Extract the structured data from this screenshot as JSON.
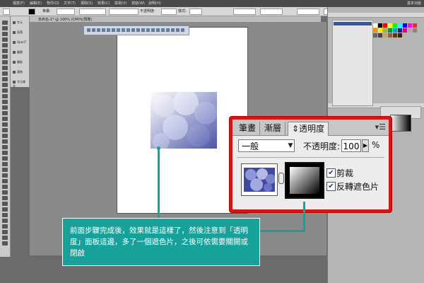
{
  "menubar": {
    "items": [
      "檔案(F)",
      "編輯(E)",
      "物件(O)",
      "文字(T)",
      "選取(S)",
      "效果(C)",
      "檢視(V)",
      "視窗(W)",
      "說明(H)"
    ],
    "workspace": "基本功能"
  },
  "control_bar": {
    "stroke_label": "筆畫:",
    "opacity_label": "不透明度:",
    "style_label": "樣式:"
  },
  "doc_tab": {
    "title": "未命名-1* @ 100% (CMYK/預覽)"
  },
  "left_panel": {
    "items": [
      "字元",
      "段落",
      "OpenT",
      "圖層",
      "畫板",
      "連結",
      "字元樣式"
    ]
  },
  "right_panel": {
    "swatch_colors": [
      "#ffffff",
      "#000000",
      "#ff0000",
      "#ffff00",
      "#00ff00",
      "#00ffff",
      "#0000ff",
      "#ff00ff",
      "#e6332a",
      "#f39800",
      "#fff100",
      "#8fc31f",
      "#009944",
      "#00a0e9",
      "#1d2088",
      "#e4007f",
      "#aaaaaa",
      "#888888",
      "#666666",
      "#444444",
      "#c9a063",
      "#8c6239",
      "#603813",
      "#42210b"
    ]
  },
  "transparency_panel": {
    "tabs": [
      "筆畫",
      "漸層",
      "透明度"
    ],
    "active_tab": "透明度",
    "blend_mode": "一般",
    "opacity_label": "不透明度:",
    "opacity_value": "100",
    "opacity_unit": "%",
    "clip_label": "剪裁",
    "clip_checked": true,
    "invert_label": "反轉遮色片",
    "invert_checked": true
  },
  "callout": {
    "text": "前面步驟完成後，效果就是這樣了，然後注意到「透明度」面板這邊，多了一個遮色片，之後可依需要關開或閉啟"
  }
}
